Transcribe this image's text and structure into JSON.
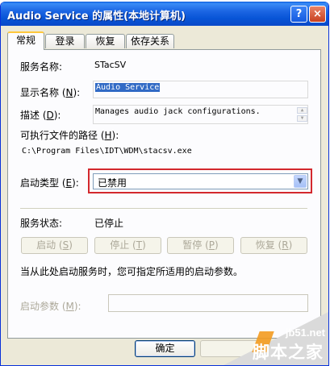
{
  "window": {
    "title": "Audio Service 的属性(本地计算机)",
    "help_label": "?",
    "close_label": "×"
  },
  "tabs": [
    {
      "label": "常规",
      "active": true
    },
    {
      "label": "登录",
      "active": false
    },
    {
      "label": "恢复",
      "active": false
    },
    {
      "label": "依存关系",
      "active": false
    }
  ],
  "general": {
    "service_name_label": "服务名称:",
    "service_name_value": "STacSV",
    "display_name_label_a": "显示名称 (",
    "display_name_label_key": "N",
    "display_name_label_b": "):",
    "display_name_value": "Audio Service",
    "description_label_a": "描述 (",
    "description_label_key": "D",
    "description_label_b": "):",
    "description_value": "Manages audio jack configurations.",
    "path_label_a": "可执行文件的路径 (",
    "path_label_key": "H",
    "path_label_b": "):",
    "path_value": "C:\\Program Files\\IDT\\WDM\\stacsv.exe",
    "startup_type_label_a": "启动类型 (",
    "startup_type_label_key": "E",
    "startup_type_label_b": "):",
    "startup_type_value": "已禁用",
    "status_label": "服务状态:",
    "status_value": "已停止",
    "hint_text": "当从此处启动服务时，您可指定所适用的启动参数。",
    "params_label_a": "启动参数 (",
    "params_label_key": "M",
    "params_label_b": "):"
  },
  "buttons": {
    "start_a": "启动 (",
    "start_key": "S",
    "start_b": ")",
    "stop_a": "停止 (",
    "stop_key": "T",
    "stop_b": ")",
    "pause_a": "暂停 (",
    "pause_key": "P",
    "pause_b": ")",
    "resume_a": "恢复 (",
    "resume_key": "R",
    "resume_b": ")",
    "ok": "确定"
  },
  "watermark": {
    "line1": "jb51.net",
    "line2": "脚本之家"
  },
  "colors": {
    "highlight": "#d3282d",
    "titlebar": "#0754d6",
    "selection": "#316ac5"
  }
}
